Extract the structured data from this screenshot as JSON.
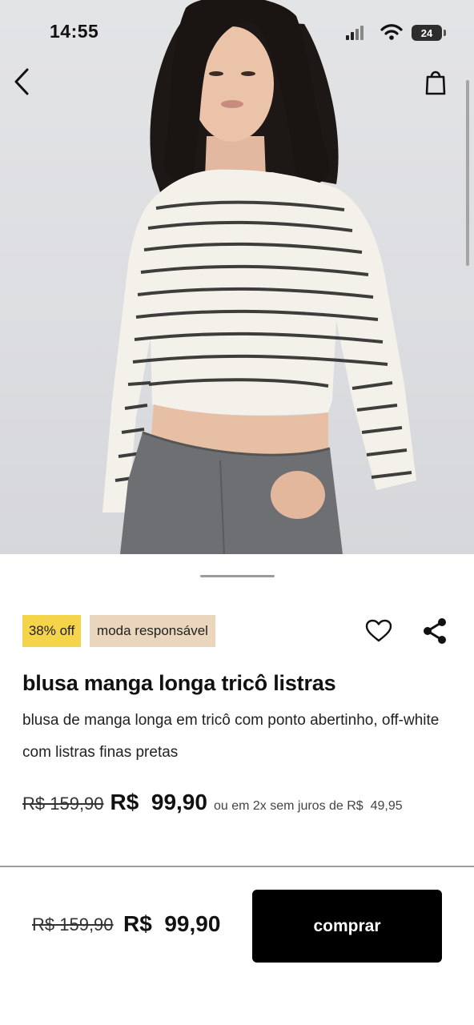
{
  "status_bar": {
    "time": "14:55",
    "battery": "24",
    "icons": [
      "signal-icon",
      "wifi-icon",
      "battery-icon"
    ]
  },
  "header": {
    "back_icon": "chevron-left-icon",
    "bag_icon": "shopping-bag-icon"
  },
  "product": {
    "image_alt_icon": "product-photo",
    "badges": {
      "discount": "38% off",
      "eco": "moda responsável"
    },
    "title": "blusa manga longa tricô listras",
    "description": "blusa de manga longa em tricô com ponto abertinho, off-white com listras finas pretas",
    "price": {
      "old": "R$ 159,90",
      "new": "R$  99,90",
      "installments": "ou em 2x sem juros de R$  49,95"
    },
    "actions": {
      "favorite_icon": "heart-icon",
      "share_icon": "share-icon"
    }
  },
  "bottom_bar": {
    "old_price": "R$ 159,90",
    "new_price": "R$  99,90",
    "buy_label": "comprar"
  },
  "colors": {
    "discount_badge": "#f3d44b",
    "eco_badge": "#ead6bd",
    "buy_button": "#000000"
  }
}
